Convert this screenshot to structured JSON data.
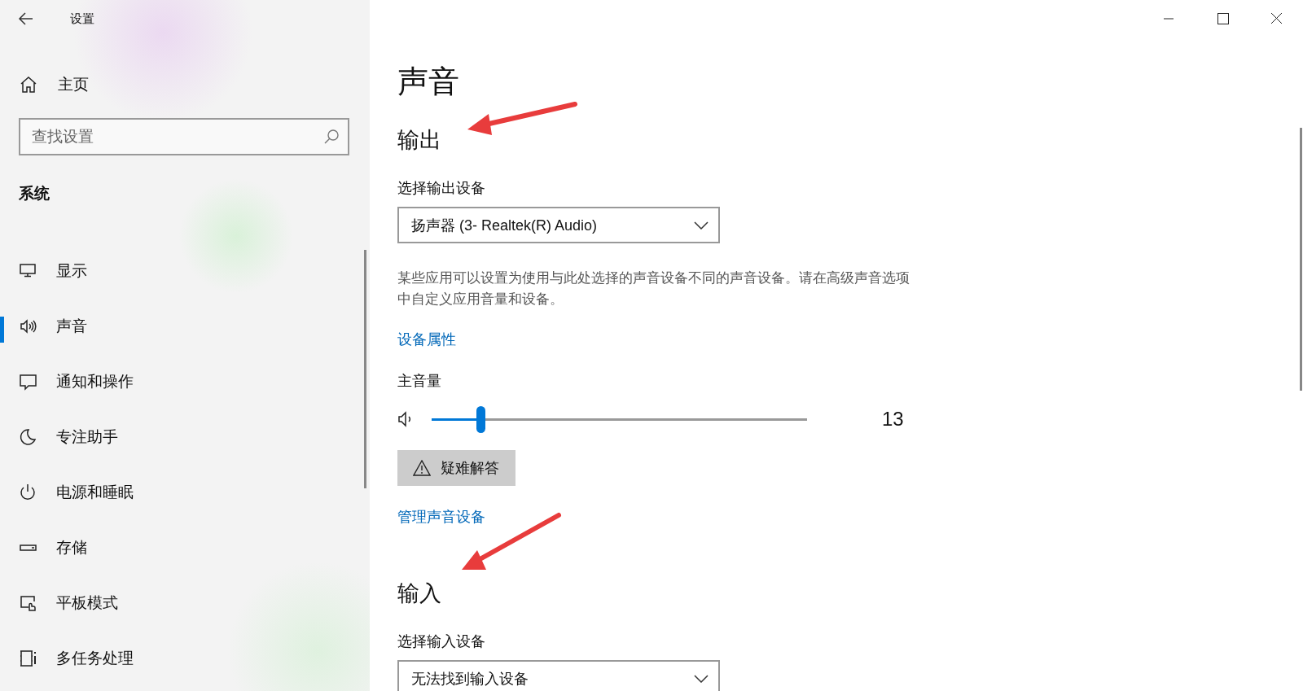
{
  "window": {
    "title": "设置"
  },
  "sidebar": {
    "home": "主页",
    "search": {
      "placeholder": "查找设置"
    },
    "section": "系统",
    "items": [
      {
        "label": "显示",
        "kind": "display",
        "selected": false
      },
      {
        "label": "声音",
        "kind": "sound",
        "selected": true
      },
      {
        "label": "通知和操作",
        "kind": "notify",
        "selected": false
      },
      {
        "label": "专注助手",
        "kind": "moon",
        "selected": false
      },
      {
        "label": "电源和睡眠",
        "kind": "power",
        "selected": false
      },
      {
        "label": "存储",
        "kind": "storage",
        "selected": false
      },
      {
        "label": "平板模式",
        "kind": "tablet",
        "selected": false
      },
      {
        "label": "多任务处理",
        "kind": "multitask",
        "selected": false
      }
    ]
  },
  "page": {
    "title": "声音",
    "output": {
      "heading": "输出",
      "device_label": "选择输出设备",
      "device": "扬声器 (3- Realtek(R) Audio)",
      "description": "某些应用可以设置为使用与此处选择的声音设备不同的声音设备。请在高级声音选项中自定义应用音量和设备。",
      "properties_link": "设备属性",
      "volume_label": "主音量",
      "volume": {
        "level": 0.13,
        "reading": "13"
      },
      "troubleshoot_button": "疑难解答",
      "manage_link": "管理声音设备"
    },
    "input": {
      "heading": "输入",
      "device_label": "选择输入设备",
      "device": "无法找到输入设备"
    }
  }
}
